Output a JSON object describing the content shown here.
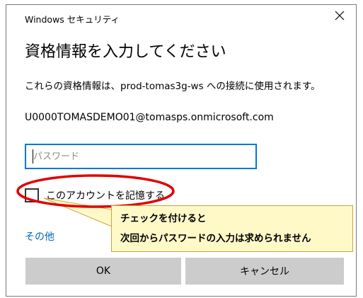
{
  "window": {
    "app_title": "Windows セキュリティ",
    "close_glyph": "✕"
  },
  "dialog": {
    "heading": "資格情報を入力してください",
    "description": "これらの資格情報は、prod-tomas3g-ws への接続に使用されます。",
    "account": "U0000TOMASDEMO01@tomasps.onmicrosoft.com",
    "password_placeholder": "パスワード",
    "password_value": "",
    "remember_label": "このアカウントを記憶する",
    "remember_checked": false,
    "more_choices": "その他",
    "ok_label": "OK",
    "cancel_label": "キャンセル"
  },
  "annotation": {
    "line1": "チェックを付けると",
    "line2": "次回からパスワードの入力は求められません",
    "ellipse_color": "#e00000",
    "callout_bg": "#fff9c8"
  },
  "colors": {
    "accent": "#0078d7",
    "link": "#0067b8",
    "button_bg": "#cccccc"
  }
}
